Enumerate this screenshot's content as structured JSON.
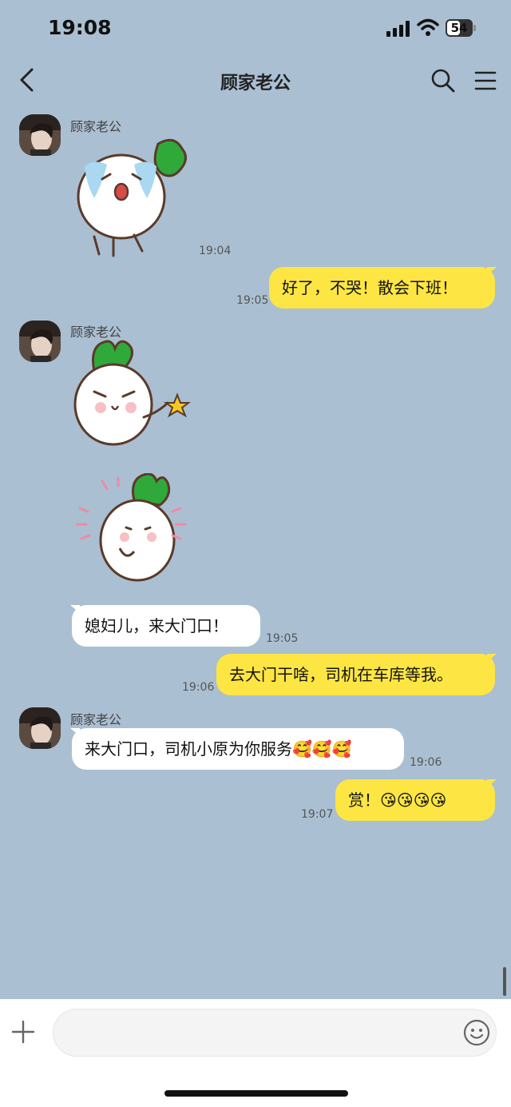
{
  "status_bar": {
    "time": "19:08",
    "battery": "54"
  },
  "nav": {
    "title": "顾家老公"
  },
  "messages": [
    {
      "kind": "sticker",
      "sender": "顾家老公",
      "sticker": "radish-crying-sticker",
      "time": "19:04"
    },
    {
      "kind": "text",
      "direction": "out",
      "text": "好了，不哭！散会下班！",
      "time": "19:05"
    },
    {
      "kind": "sticker",
      "sender": "顾家老公",
      "sticker": "radish-pointing-star-sticker"
    },
    {
      "kind": "sticker",
      "sticker": "radish-giggling-sticker"
    },
    {
      "kind": "text",
      "direction": "in",
      "text": "媳妇儿，来大门口！",
      "time": "19:05"
    },
    {
      "kind": "text",
      "direction": "out",
      "text": "去大门干啥，司机在车库等我。",
      "time": "19:06"
    },
    {
      "kind": "text",
      "direction": "in",
      "sender": "顾家老公",
      "text": "来大门口，司机小原为你服务🥰🥰🥰",
      "time": "19:06"
    },
    {
      "kind": "text",
      "direction": "out",
      "text": "赏！😘😘😘😘",
      "time": "19:07"
    }
  ],
  "input": {
    "value": "",
    "placeholder": ""
  },
  "colors": {
    "background": "#aabfd2",
    "outgoing_bubble": "#fde643",
    "incoming_bubble": "#ffffff",
    "sticker_leaf": "#2faa3a"
  }
}
